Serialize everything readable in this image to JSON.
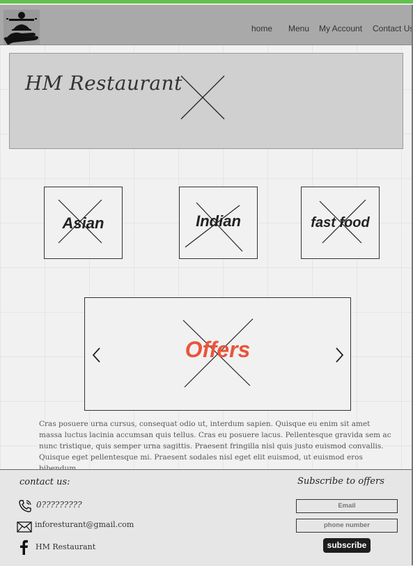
{
  "nav": {
    "items": [
      {
        "label": "home"
      },
      {
        "label": "Menu"
      },
      {
        "label": "My Account"
      },
      {
        "label": "Contact Us"
      }
    ]
  },
  "logo": {
    "icon": "restaurant-serving-hand-icon"
  },
  "hero": {
    "title": "HM Restaurant",
    "image_icon": "image-placeholder-icon"
  },
  "categories": [
    {
      "label": "Asian"
    },
    {
      "label": "Indian"
    },
    {
      "label": "fast food"
    }
  ],
  "offers": {
    "label": "Offers",
    "label_color": "#e8553b",
    "prev_icon": "chevron-left-icon",
    "next_icon": "chevron-right-icon"
  },
  "paragraph": "Cras posuere urna cursus, consequat odio ut, interdum sapien. Quisque eu enim sit amet massa luctus lacinia accumsan quis tellus. Cras eu posuere lacus. Pellentesque gravida sem ac nunc tristique, quis semper urna sagittis. Praesent fringilla nisl quis justo euismod convallis. Quisque eget pellentesque mi. Praesent sodales nisl eget elit euismod, ut euismod eros bibendum.",
  "footer": {
    "contact_heading": "contact us:",
    "phone": "0?????????",
    "email": "inforesturant@gmail.com",
    "facebook": "HM Restaurant",
    "subscribe_heading": "Subscribe to offers",
    "email_placeholder": "Email",
    "phone_placeholder": "phone number",
    "subscribe_button": "subscribe"
  },
  "colors": {
    "accent_green": "#62c04c",
    "navbar": "#a9a9a9",
    "hero_bg": "#d0d0d0"
  }
}
